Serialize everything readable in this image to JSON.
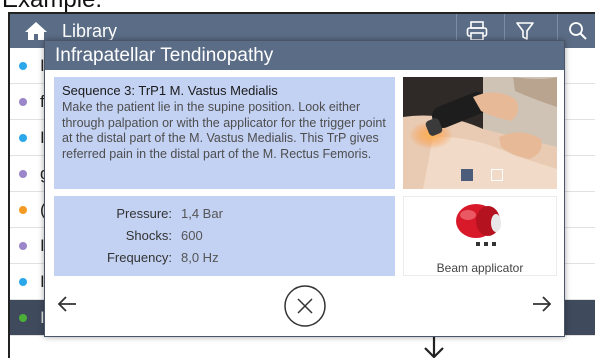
{
  "caption": "Example:",
  "topbar": {
    "title": "Library",
    "icons": [
      "home-icon",
      "print-icon",
      "filter-icon",
      "search-icon"
    ]
  },
  "list": {
    "items": [
      {
        "text": "I",
        "color": "#2aa7e8"
      },
      {
        "text": "f",
        "color": "#9a86c8"
      },
      {
        "text": "I",
        "color": "#2aa7e8"
      },
      {
        "text": "g",
        "color": "#9a86c8"
      },
      {
        "text": "(",
        "color": "#f39a23"
      },
      {
        "text": "I",
        "color": "#9a86c8"
      },
      {
        "text": "I",
        "color": "#2aa7e8"
      },
      {
        "text": "I",
        "color": "#4caf3a"
      }
    ]
  },
  "modal": {
    "title": "Infrapatellar Tendinopathy",
    "sequence_heading": "Sequence 3: TrP1 M. Vastus Medialis",
    "description": "Make the patient lie in the supine position. Look either through palpation or with the applicator for the trigger point at the distal part of the M. Vastus Medialis. This TrP gives referred pain in the distal part of the M. Rectus Femoris.",
    "image_pages": {
      "count": 2,
      "active": 0
    },
    "params": {
      "pressure_label": "Pressure:",
      "pressure_value": "1,4 Bar",
      "shocks_label": "Shocks:",
      "shocks_value": "600",
      "frequency_label": "Frequency:",
      "frequency_value": "8,0 Hz"
    },
    "applicator_label": "Beam applicator",
    "icons": [
      "arrow-left-icon",
      "close-icon",
      "arrow-right-icon"
    ]
  },
  "colors": {
    "header": "#5b6d86",
    "panel": "#c3d1f3",
    "selected_row": "#3f4a5c",
    "applicator_red": "#d8192a"
  }
}
